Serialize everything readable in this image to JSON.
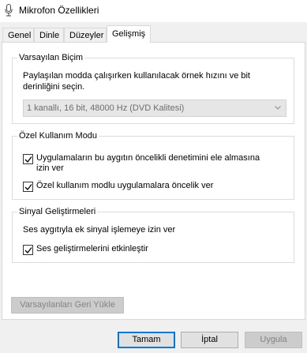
{
  "window": {
    "title": "Mikrofon Özellikleri"
  },
  "tabs": [
    {
      "label": "Genel",
      "active": false
    },
    {
      "label": "Dinle",
      "active": false
    },
    {
      "label": "Düzeyler",
      "active": false
    },
    {
      "label": "Gelişmiş",
      "active": true
    }
  ],
  "default_format": {
    "legend": "Varsayılan Biçim",
    "description_line1": "Paylaşılan modda çalışırken kullanılacak örnek hızını ve bit",
    "description_line2": "derinliğini seçin.",
    "selected_value": "1 kanallı, 16 bit, 48000 Hz (DVD Kalitesi)"
  },
  "exclusive_mode": {
    "legend": "Özel Kullanım Modu",
    "option1_line1": "Uygulamaların bu aygıtın öncelikli denetimini ele almasına",
    "option1_line2": "izin ver",
    "option1_checked": true,
    "option2": "Özel kullanım modlu uygulamalara öncelik ver",
    "option2_checked": true
  },
  "signal_enhancements": {
    "legend": "Sinyal Geliştirmeleri",
    "description": "Ses aygıtıyla ek sinyal işlemeye izin ver",
    "option": "Ses geliştirmelerini etkinleştir",
    "option_checked": true
  },
  "buttons": {
    "restore_defaults": "Varsayılanları Geri Yükle",
    "ok": "Tamam",
    "cancel": "İptal",
    "apply": "Uygula"
  },
  "icons": {
    "title_icon": "microphone-icon",
    "dropdown_icon": "chevron-down-icon",
    "check_icon": "checkmark-icon"
  }
}
